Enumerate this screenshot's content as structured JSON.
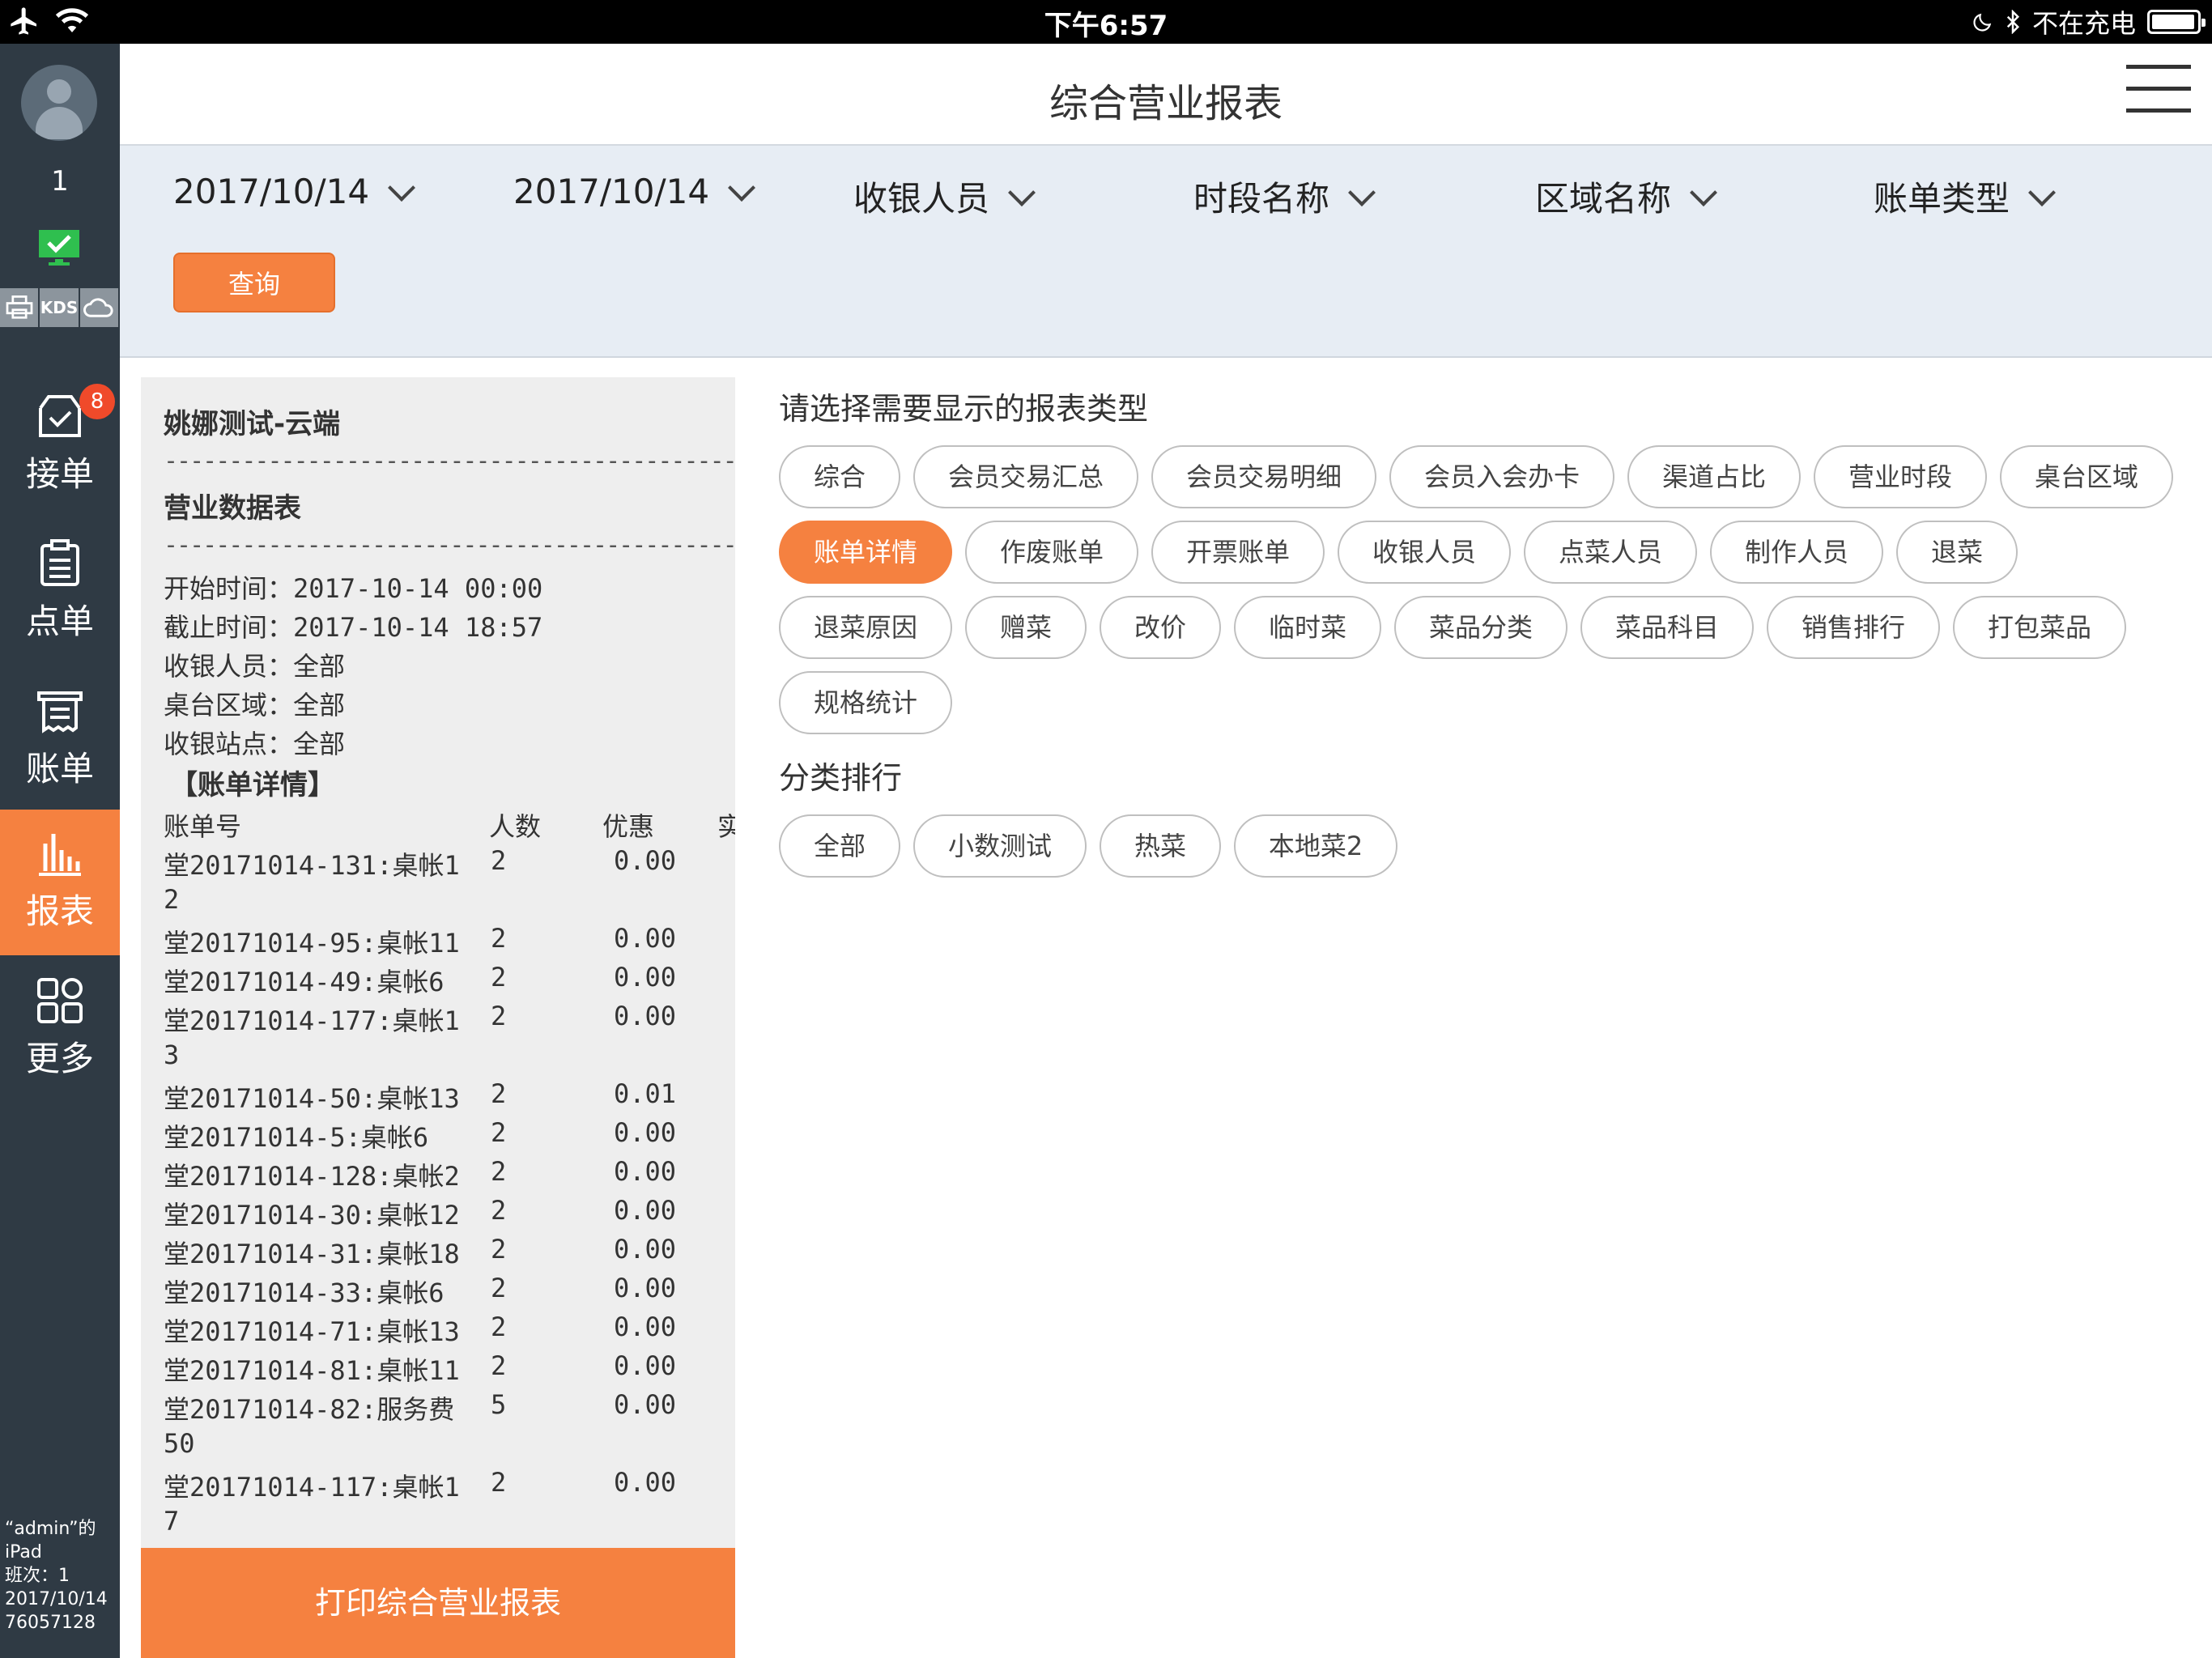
{
  "status_bar": {
    "time": "下午6:57",
    "charging": "不在充电"
  },
  "sidebar": {
    "shift_no": "1",
    "devices": [
      "KDS"
    ],
    "nav": [
      {
        "label": "接单",
        "badge": "8"
      },
      {
        "label": "点单"
      },
      {
        "label": "账单"
      },
      {
        "label": "报表"
      },
      {
        "label": "更多"
      }
    ],
    "device_info": [
      "“admin”的",
      "iPad",
      "班次：1",
      "2017/10/14",
      "76057128"
    ]
  },
  "header": {
    "title": "综合营业报表"
  },
  "filters": {
    "start_date": "2017/10/14",
    "end_date": "2017/10/14",
    "cashier": "收银人员",
    "period": "时段名称",
    "area": "区域名称",
    "bill_type": "账单类型",
    "query_label": "查询"
  },
  "receipt": {
    "shop": "姚娜测试-云端",
    "dash": "--------------------------------------------",
    "report_title": "营业数据表",
    "info": [
      "开始时间：2017-10-14 00:00",
      "截止时间：2017-10-14 18:57",
      "收银人员：全部",
      "桌台区域：全部",
      "收银站点：全部"
    ],
    "section": "【账单详情】",
    "columns": [
      "账单号",
      "人数",
      "优惠",
      "实"
    ],
    "rows": [
      {
        "bill": "堂20171014-131:桌帐1",
        "wrap": "2",
        "people": "2",
        "discount": "0.00"
      },
      {
        "bill": "堂20171014-95:桌帐11",
        "people": "2",
        "discount": "0.00"
      },
      {
        "bill": "堂20171014-49:桌帐6",
        "people": "2",
        "discount": "0.00"
      },
      {
        "bill": "堂20171014-177:桌帐1",
        "wrap": "3",
        "people": "2",
        "discount": "0.00"
      },
      {
        "bill": "堂20171014-50:桌帐13",
        "people": "2",
        "discount": "0.01"
      },
      {
        "bill": "堂20171014-5:桌帐6",
        "people": "2",
        "discount": "0.00"
      },
      {
        "bill": "堂20171014-128:桌帐2",
        "people": "2",
        "discount": "0.00"
      },
      {
        "bill": "堂20171014-30:桌帐12",
        "people": "2",
        "discount": "0.00"
      },
      {
        "bill": "堂20171014-31:桌帐18",
        "people": "2",
        "discount": "0.00"
      },
      {
        "bill": "堂20171014-33:桌帐6",
        "people": "2",
        "discount": "0.00"
      },
      {
        "bill": "堂20171014-71:桌帐13",
        "people": "2",
        "discount": "0.00"
      },
      {
        "bill": "堂20171014-81:桌帐11",
        "people": "2",
        "discount": "0.00"
      },
      {
        "bill": "堂20171014-82:服务费",
        "wrap": "50",
        "people": "5",
        "discount": "0.00"
      },
      {
        "bill": "堂20171014-117:桌帐1",
        "wrap": "7",
        "people": "2",
        "discount": "0.00"
      }
    ],
    "print_label": "打印综合营业报表"
  },
  "report_types": {
    "title": "请选择需要显示的报表类型",
    "selected": "账单详情",
    "rows": [
      [
        "综合",
        "会员交易汇总",
        "会员交易明细",
        "会员入会办卡",
        "渠道占比",
        "营业时段",
        "桌台区域"
      ],
      [
        "账单详情",
        "作废账单",
        "开票账单",
        "收银人员",
        "点菜人员",
        "制作人员",
        "退菜"
      ],
      [
        "退菜原因",
        "赠菜",
        "改价",
        "临时菜",
        "菜品分类",
        "菜品科目",
        "销售排行",
        "打包菜品"
      ],
      [
        "规格统计"
      ]
    ]
  },
  "category_rank": {
    "title": "分类排行",
    "items": [
      "全部",
      "小数测试",
      "热菜",
      "本地菜2"
    ]
  },
  "colors": {
    "accent": "#f58140",
    "sidebar": "#2f3a44",
    "filter_bg": "#e7edf4"
  }
}
